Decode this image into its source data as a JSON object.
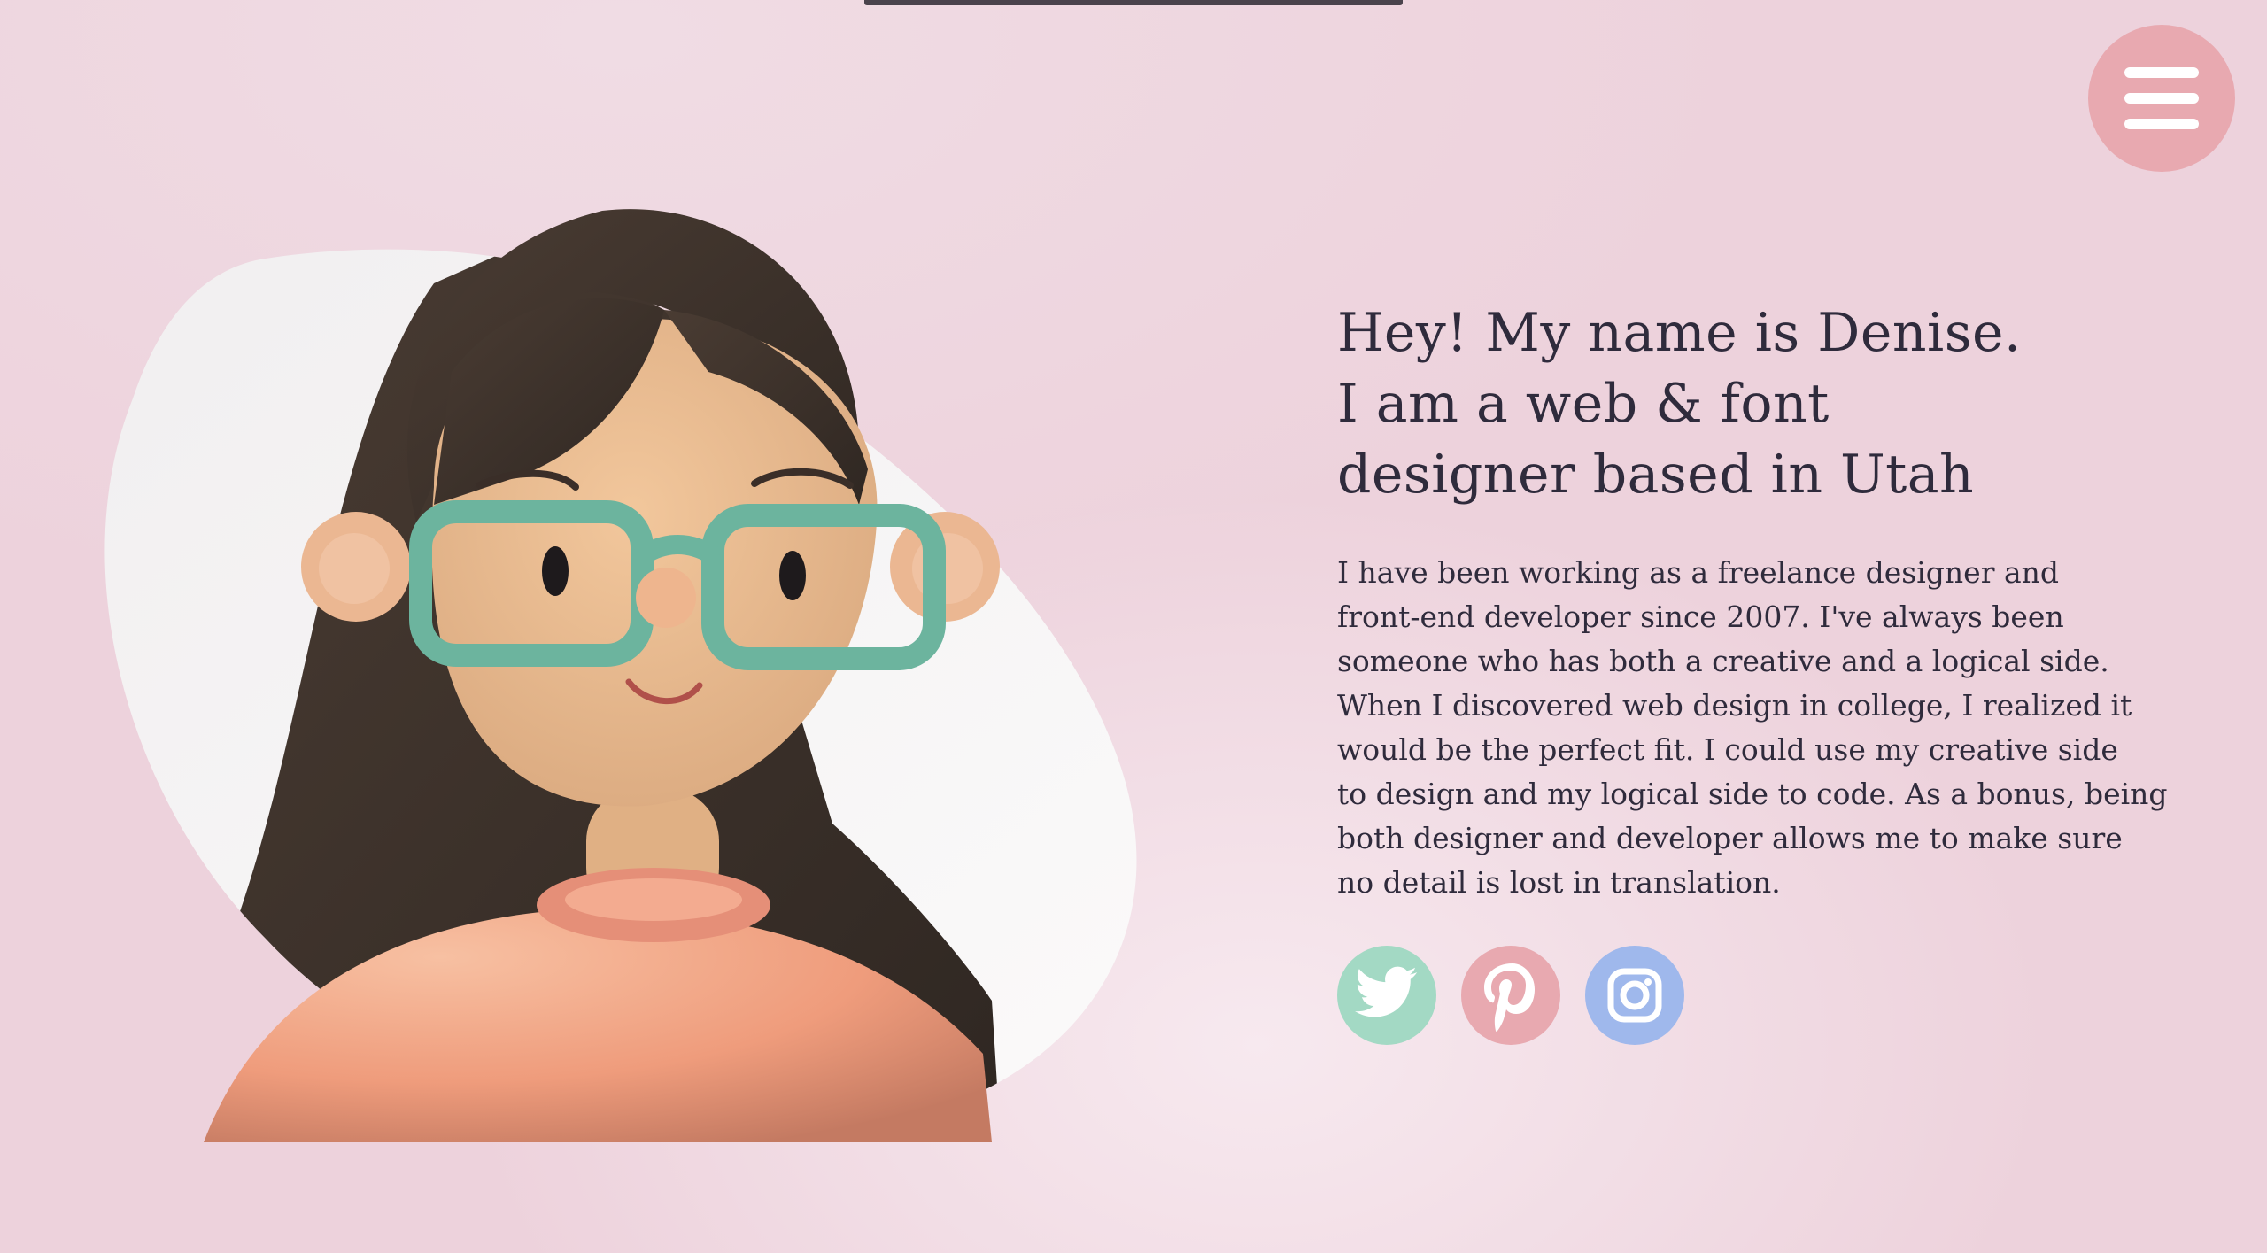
{
  "header": {
    "menu_icon": "hamburger-menu-icon"
  },
  "hero": {
    "headline_lines": [
      "Hey! My name is Denise.",
      "I am a web & font",
      "designer based in Utah"
    ],
    "bio_lines": [
      "I have been working as a freelance designer and",
      "front-end developer since 2007. I've always been",
      "someone who has both a creative and a logical side.",
      "When I discovered web design in college, I realized it",
      "would be the perfect fit. I could use my creative side",
      "to design and my logical side to code. As a bonus, being",
      "both designer and developer allows me to make sure",
      "no detail is lost in translation."
    ]
  },
  "social": [
    {
      "icon": "twitter-icon",
      "color": "#a3d9c4"
    },
    {
      "icon": "pinterest-icon",
      "color": "#e8a9b0"
    },
    {
      "icon": "instagram-icon",
      "color": "#9fb8ec"
    }
  ],
  "colors": {
    "background": "#edd2dc",
    "text": "#2f2b3c",
    "menu_button": "#e8a9b0",
    "blob": "#f5f3f4"
  }
}
